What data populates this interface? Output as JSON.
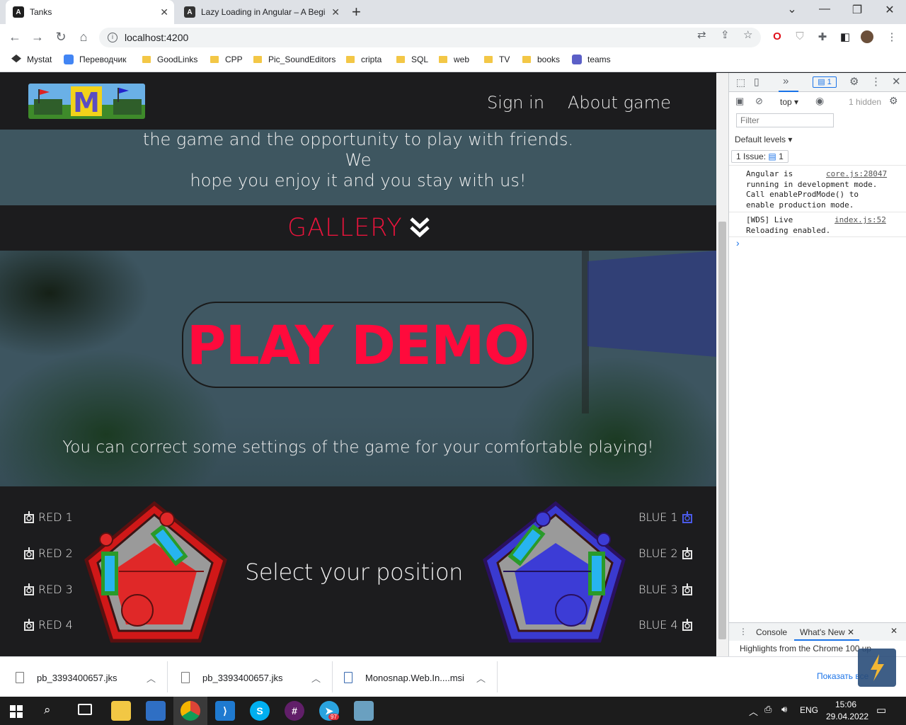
{
  "browser": {
    "tabs": [
      {
        "title": "Tanks",
        "active": true
      },
      {
        "title": "Lazy Loading in Angular – A Begi",
        "active": false
      }
    ],
    "new_tab": "+",
    "window_controls": {
      "minimize": "—",
      "maximize": "❐",
      "close": "✕",
      "menu": "⌄"
    },
    "url": "localhost:4200",
    "bookmarks": [
      {
        "label": "Mystat",
        "icon": "graduation-cap-icon"
      },
      {
        "label": "Переводчик",
        "icon": "google-translate-icon"
      },
      {
        "label": "GoodLinks",
        "icon": "folder-icon"
      },
      {
        "label": "CPP",
        "icon": "folder-icon"
      },
      {
        "label": "Pic_SoundEditors",
        "icon": "folder-icon"
      },
      {
        "label": "cripta",
        "icon": "folder-icon"
      },
      {
        "label": "SQL",
        "icon": "folder-icon"
      },
      {
        "label": "web",
        "icon": "folder-icon"
      },
      {
        "label": "TV",
        "icon": "folder-icon"
      },
      {
        "label": "books",
        "icon": "folder-icon"
      },
      {
        "label": "teams",
        "icon": "teams-icon"
      }
    ]
  },
  "site": {
    "nav": {
      "sign_in": "Sign in",
      "about": "About game"
    },
    "intro_line1": "the game and the opportunity to play with friends. We",
    "intro_line2": "hope you enjoy it and you stay with us!",
    "gallery_title": "GALLERY",
    "play_demo": "PLAY DEMO",
    "settings_text": "You can correct some settings of the game for your comfortable playing!",
    "select_title": "Select your position",
    "red_positions": [
      "RED 1",
      "RED 2",
      "RED 3",
      "RED 4"
    ],
    "blue_positions": [
      "BLUE 1",
      "BLUE 2",
      "BLUE 3",
      "BLUE 4"
    ],
    "selected_position": "BLUE 1",
    "colors": {
      "accent_red": "#ff0a3c",
      "team_red": "#e02020",
      "team_blue": "#3a3ad0",
      "dark_bg": "#1c1c1e"
    }
  },
  "devtools": {
    "issues_count": "1",
    "context": "top",
    "hidden_count": "1 hidden",
    "filter_placeholder": "Filter",
    "levels": "Default levels",
    "issue_label": "1 Issue:",
    "issue_badge": "1",
    "messages": [
      {
        "text": "Angular is running in development mode. Call enableProdMode() to enable production mode.",
        "source": "core.js:28047",
        "lines": [
          "Angular is",
          "running in development mode.",
          "Call enableProdMode() to",
          "enable production mode."
        ]
      },
      {
        "text": "[WDS] Live Reloading enabled.",
        "source": "index.js:52",
        "lines": [
          "[WDS] Live",
          "Reloading enabled."
        ]
      }
    ],
    "prompt": "›",
    "drawer_tabs": [
      "Console",
      "What's New"
    ],
    "drawer_text": "Highlights from the Chrome 100 up"
  },
  "downloads": {
    "items": [
      "pb_3393400657.jks",
      "pb_3393400657.jks",
      "Monosnap.Web.In....msi"
    ],
    "show_all": "Показать все"
  },
  "taskbar": {
    "lang": "ENG",
    "time": "15:06",
    "date": "29.04.2022",
    "telegram_badge": "97"
  }
}
